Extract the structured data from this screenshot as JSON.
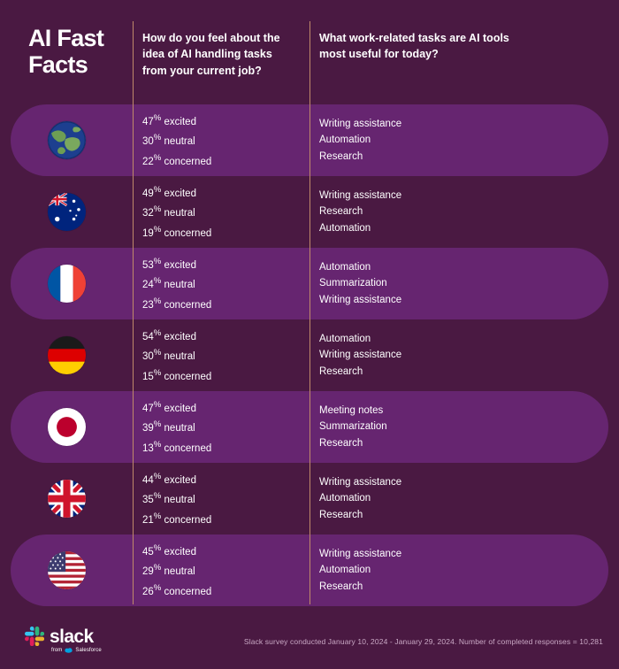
{
  "header": {
    "title": "AI Fast Facts",
    "question_1": "How do you feel about the idea of AI handling tasks  from your current job?",
    "question_2": "What work-related tasks are AI tools most useful for today?"
  },
  "rows": [
    {
      "region": "world",
      "flag_icon": "globe-earth-icon",
      "sentiment": [
        {
          "value": "47",
          "unit": "%",
          "label": "excited"
        },
        {
          "value": "30",
          "unit": "%",
          "label": "neutral"
        },
        {
          "value": "22",
          "unit": "%",
          "label": "concerned"
        }
      ],
      "tasks": [
        "Writing assistance",
        "Automation",
        "Research"
      ]
    },
    {
      "region": "australia",
      "flag_icon": "flag-australia-icon",
      "sentiment": [
        {
          "value": "49",
          "unit": "%",
          "label": "excited"
        },
        {
          "value": "32",
          "unit": "%",
          "label": "neutral"
        },
        {
          "value": "19",
          "unit": "%",
          "label": "concerned"
        }
      ],
      "tasks": [
        "Writing assistance",
        "Research",
        "Automation"
      ]
    },
    {
      "region": "france",
      "flag_icon": "flag-france-icon",
      "sentiment": [
        {
          "value": "53",
          "unit": "%",
          "label": "excited"
        },
        {
          "value": "24",
          "unit": "%",
          "label": "neutral"
        },
        {
          "value": "23",
          "unit": "%",
          "label": "concerned"
        }
      ],
      "tasks": [
        "Automation",
        "Summarization",
        "Writing assistance"
      ]
    },
    {
      "region": "germany",
      "flag_icon": "flag-germany-icon",
      "sentiment": [
        {
          "value": "54",
          "unit": "%",
          "label": "excited"
        },
        {
          "value": "30",
          "unit": "%",
          "label": "neutral"
        },
        {
          "value": "15",
          "unit": "%",
          "label": "concerned"
        }
      ],
      "tasks": [
        "Automation",
        "Writing assistance",
        "Research"
      ]
    },
    {
      "region": "japan",
      "flag_icon": "flag-japan-icon",
      "sentiment": [
        {
          "value": "47",
          "unit": "%",
          "label": "excited"
        },
        {
          "value": "39",
          "unit": "%",
          "label": "neutral"
        },
        {
          "value": "13",
          "unit": "%",
          "label": "concerned"
        }
      ],
      "tasks": [
        "Meeting notes",
        "Summarization",
        "Research"
      ]
    },
    {
      "region": "united-kingdom",
      "flag_icon": "flag-united-kingdom-icon",
      "sentiment": [
        {
          "value": "44",
          "unit": "%",
          "label": "excited"
        },
        {
          "value": "35",
          "unit": "%",
          "label": "neutral"
        },
        {
          "value": "21",
          "unit": "%",
          "label": "concerned"
        }
      ],
      "tasks": [
        "Writing assistance",
        "Automation",
        "Research"
      ]
    },
    {
      "region": "united-states",
      "flag_icon": "flag-united-states-icon",
      "sentiment": [
        {
          "value": "45",
          "unit": "%",
          "label": "excited"
        },
        {
          "value": "29",
          "unit": "%",
          "label": "neutral"
        },
        {
          "value": "26",
          "unit": "%",
          "label": "concerned"
        }
      ],
      "tasks": [
        "Writing assistance",
        "Automation",
        "Research"
      ]
    }
  ],
  "footer": {
    "brand": "slack",
    "brand_tagline_prefix": "from",
    "brand_tagline_suffix": "Salesforce",
    "survey_note": "Slack survey conducted January 10, 2024 - January 29, 2024. Number of completed responses = 10,281"
  },
  "colors": {
    "background": "#4a1942",
    "pill": "#662570",
    "divider": "#c08a6a",
    "text": "#ffffff",
    "note_text": "#c9a8c4"
  }
}
